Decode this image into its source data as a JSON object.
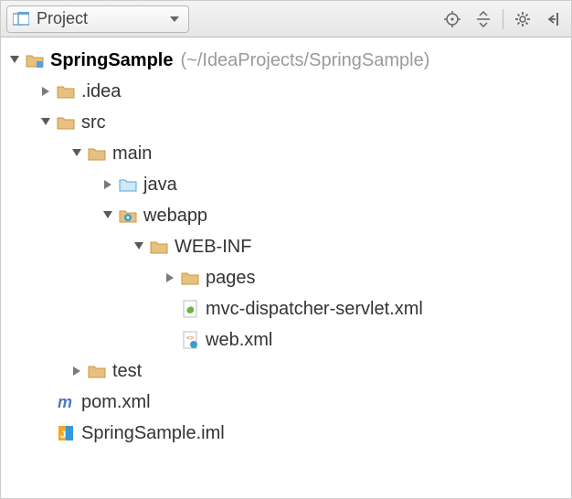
{
  "toolbar": {
    "project_label": "Project"
  },
  "tree": {
    "root": {
      "name": "SpringSample",
      "path_hint": "(~/IdeaProjects/SpringSample)"
    },
    "idea": ".idea",
    "src": "src",
    "main": "main",
    "java": "java",
    "webapp": "webapp",
    "webinf": "WEB-INF",
    "pages": "pages",
    "dispatcher": "mvc-dispatcher-servlet.xml",
    "webxml": "web.xml",
    "test": "test",
    "pom": "pom.xml",
    "iml": "SpringSample.iml"
  }
}
